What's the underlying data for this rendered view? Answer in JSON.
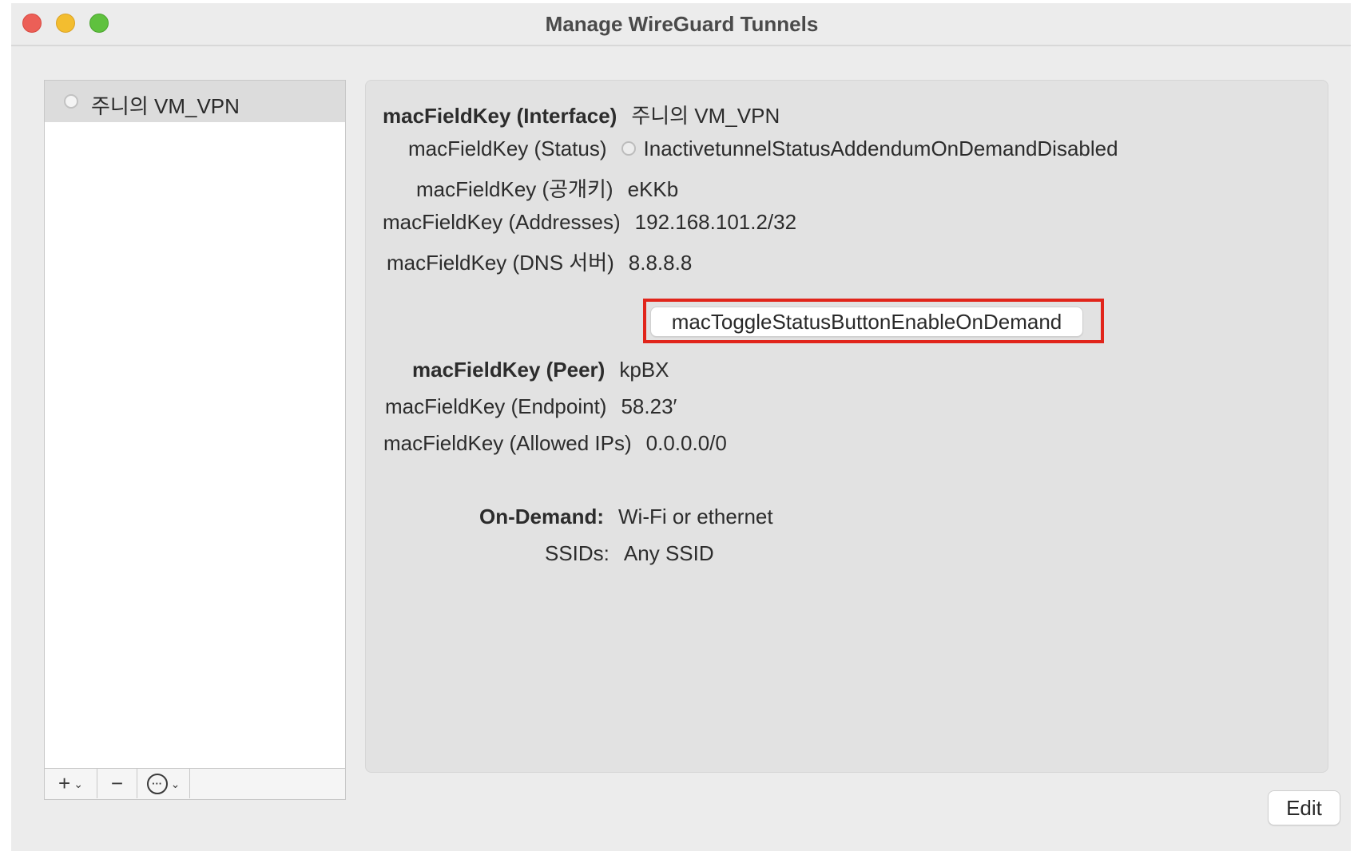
{
  "window": {
    "title": "Manage WireGuard Tunnels"
  },
  "sidebar": {
    "items": [
      {
        "name": "주니의 VM_VPN",
        "status": "inactive"
      }
    ],
    "toolbar": {
      "add_label": "+",
      "remove_label": "−",
      "more_label": "···"
    }
  },
  "interface": {
    "name_key": "macFieldKey (Interface)",
    "name_value": "주니의 VM_VPN",
    "status_key": "macFieldKey (Status)",
    "status_value": "InactivetunnelStatusAddendumOnDemandDisabled",
    "pubkey_key": "macFieldKey (공개키)",
    "pubkey_value": "eKKb",
    "addresses_key": "macFieldKey (Addresses)",
    "addresses_value": "192.168.101.2/32",
    "dns_key": "macFieldKey (DNS 서버)",
    "dns_value": "8.8.8.8",
    "toggle_button_label": "macToggleStatusButtonEnableOnDemand"
  },
  "peer": {
    "name_key": "macFieldKey (Peer)",
    "name_value": "kpBX",
    "endpoint_key": "macFieldKey (Endpoint)",
    "endpoint_value": "58.23′",
    "allowed_ips_key": "macFieldKey (Allowed IPs)",
    "allowed_ips_value": "0.0.0.0/0"
  },
  "on_demand": {
    "on_demand_key": "On-Demand:",
    "on_demand_value": "Wi-Fi or ethernet",
    "ssids_key": "SSIDs:",
    "ssids_value": "Any SSID"
  },
  "footer": {
    "edit_label": "Edit"
  },
  "colors": {
    "highlight": "#e1251b",
    "close": "#ec5f57",
    "minimize": "#f3bd2f",
    "maximize": "#5fc13e"
  }
}
